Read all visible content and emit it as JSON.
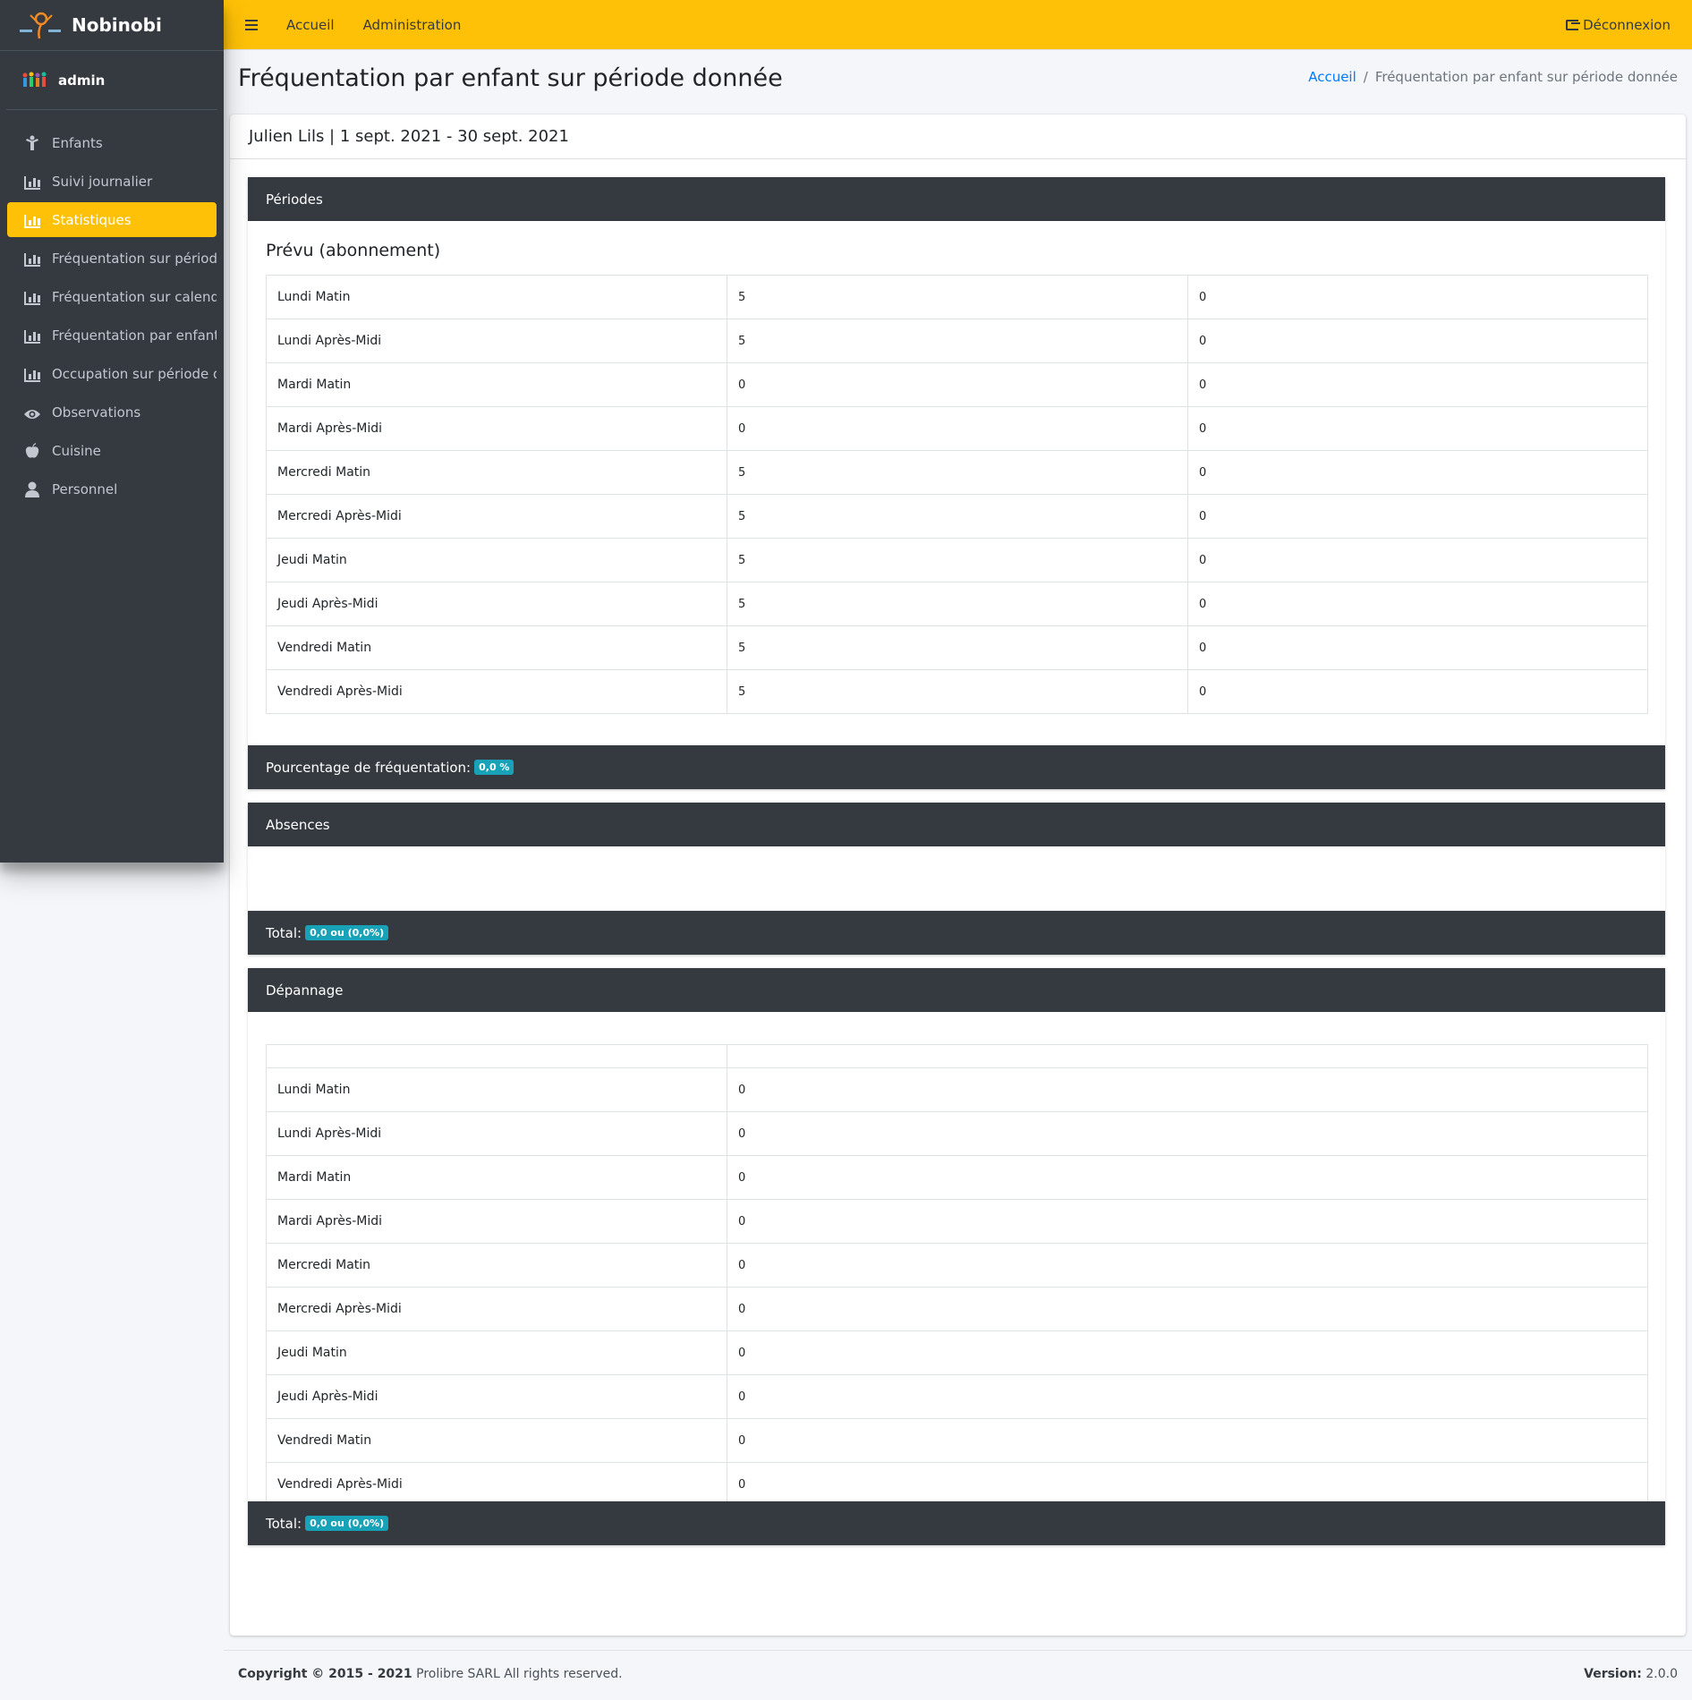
{
  "brand": {
    "name": "Nobinobi"
  },
  "user": {
    "name": "admin"
  },
  "sidebar": {
    "items": [
      {
        "label": "Enfants",
        "icon": "child-icon"
      },
      {
        "label": "Suivi journalier",
        "icon": "bar-chart-icon"
      },
      {
        "label": "Statistiques",
        "icon": "bar-chart-icon",
        "active": true
      },
      {
        "label": "Fréquentation sur période d",
        "icon": "bar-chart-icon"
      },
      {
        "label": "Fréquentation sur calendrie",
        "icon": "bar-chart-icon"
      },
      {
        "label": "Fréquentation par enfant su",
        "icon": "bar-chart-icon"
      },
      {
        "label": "Occupation sur période don",
        "icon": "bar-chart-icon"
      },
      {
        "label": "Observations",
        "icon": "eye-icon"
      },
      {
        "label": "Cuisine",
        "icon": "apple-icon"
      },
      {
        "label": "Personnel",
        "icon": "user-icon"
      }
    ]
  },
  "topbar": {
    "links": [
      "Accueil",
      "Administration"
    ],
    "logout_label": "Déconnexion"
  },
  "page": {
    "title": "Fréquentation par enfant sur période donnée",
    "breadcrumb": {
      "home": "Accueil",
      "current": "Fréquentation par enfant sur période donnée"
    }
  },
  "card": {
    "header": "Julien Lils | 1 sept. 2021 - 30 sept. 2021"
  },
  "periodes": {
    "title": "Périodes",
    "subtitle": "Prévu (abonnement)",
    "rows": [
      [
        "Lundi Matin",
        "5",
        "0"
      ],
      [
        "Lundi Après-Midi",
        "5",
        "0"
      ],
      [
        "Mardi Matin",
        "0",
        "0"
      ],
      [
        "Mardi Après-Midi",
        "0",
        "0"
      ],
      [
        "Mercredi Matin",
        "5",
        "0"
      ],
      [
        "Mercredi Après-Midi",
        "5",
        "0"
      ],
      [
        "Jeudi Matin",
        "5",
        "0"
      ],
      [
        "Jeudi Après-Midi",
        "5",
        "0"
      ],
      [
        "Vendredi Matin",
        "5",
        "0"
      ],
      [
        "Vendredi Après-Midi",
        "5",
        "0"
      ]
    ],
    "percentage_label": "Pourcentage de fréquentation:",
    "percentage_value": "0,0 %"
  },
  "absences": {
    "title": "Absences",
    "total_label": "Total:",
    "total_value": "0,0 ou (0,0%)"
  },
  "depannage": {
    "title": "Dépannage",
    "rows": [
      [
        "Lundi Matin",
        "0"
      ],
      [
        "Lundi Après-Midi",
        "0"
      ],
      [
        "Mardi Matin",
        "0"
      ],
      [
        "Mardi Après-Midi",
        "0"
      ],
      [
        "Mercredi Matin",
        "0"
      ],
      [
        "Mercredi Après-Midi",
        "0"
      ],
      [
        "Jeudi Matin",
        "0"
      ],
      [
        "Jeudi Après-Midi",
        "0"
      ],
      [
        "Vendredi Matin",
        "0"
      ],
      [
        "Vendredi Après-Midi",
        "0"
      ]
    ],
    "total_label": "Total:",
    "total_value": "0,0 ou (0,0%)"
  },
  "footer": {
    "copyright_bold": "Copyright © 2015 - 2021",
    "copyright_rest": " Prolibre SARL All rights reserved.",
    "version_label": "Version:",
    "version_value": " 2.0.0"
  },
  "colors": {
    "accent": "#ffc107",
    "sidebar_bg": "#343a40",
    "badge": "#17a2b8",
    "link": "#007bff"
  }
}
